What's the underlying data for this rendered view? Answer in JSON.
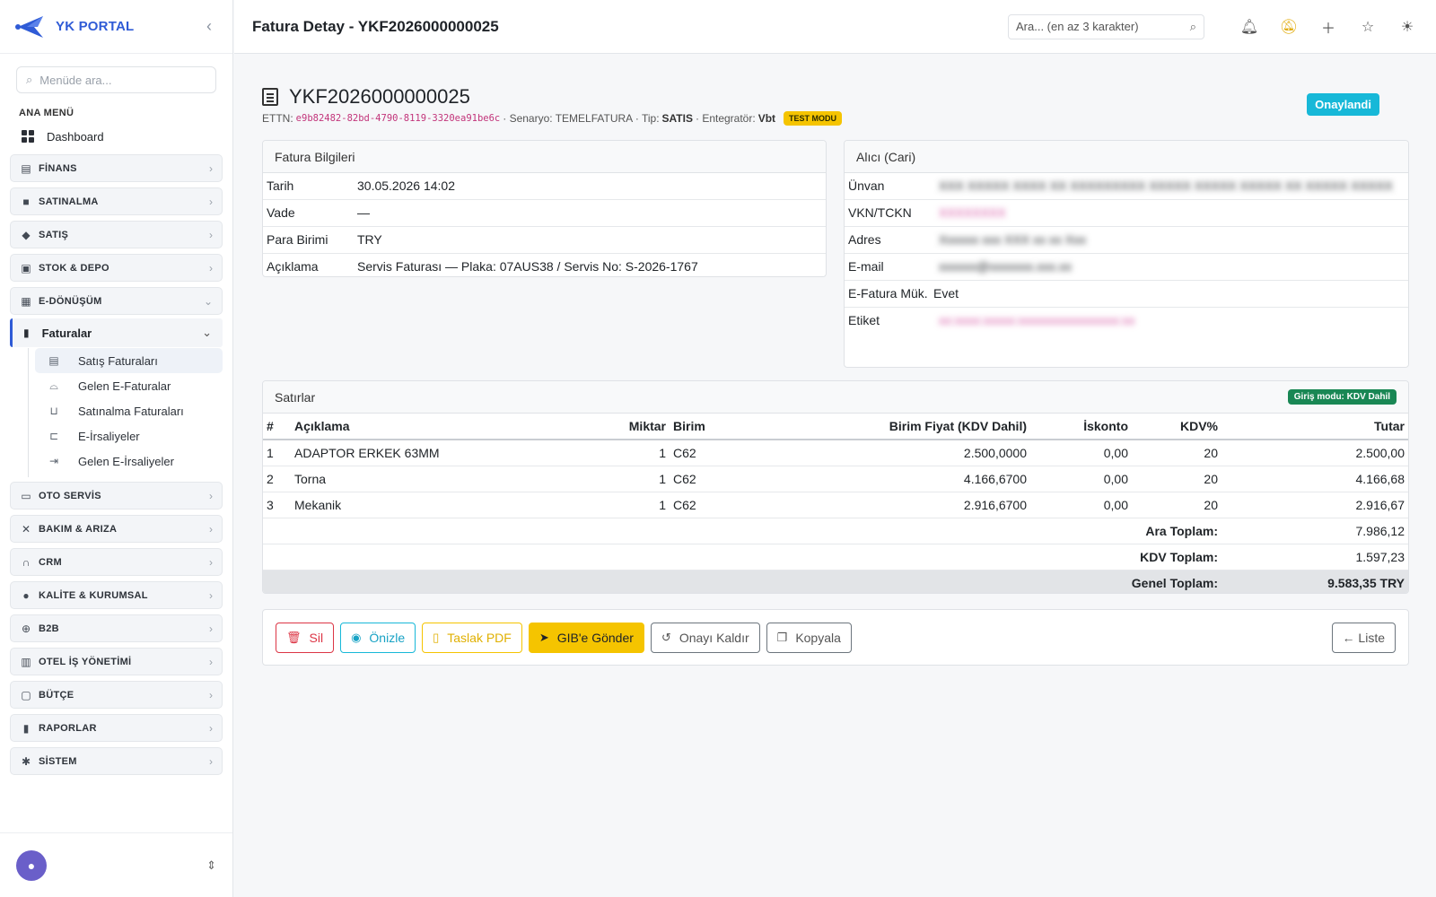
{
  "brand": {
    "name": "YK PORTAL"
  },
  "sidebar": {
    "search_placeholder": "Menüde ara...",
    "section_title": "ANA MENÜ",
    "dashboard_label": "Dashboard",
    "groups": [
      {
        "label": "FİNANS",
        "icon": "bank-icon"
      },
      {
        "label": "SATINALMA",
        "icon": "bag-icon"
      },
      {
        "label": "SATIŞ",
        "icon": "tag-icon"
      },
      {
        "label": "STOK & DEPO",
        "icon": "box-icon"
      },
      {
        "label": "E-DÖNÜŞÜM",
        "icon": "document-icon"
      }
    ],
    "faturalar_label": "Faturalar",
    "sub_items": [
      {
        "label": "Satış Faturaları",
        "icon": "receipt-icon"
      },
      {
        "label": "Gelen E-Faturalar",
        "icon": "inbox-icon"
      },
      {
        "label": "Satınalma Faturaları",
        "icon": "cart-icon"
      },
      {
        "label": "E-İrsaliyeler",
        "icon": "truck-icon"
      },
      {
        "label": "Gelen E-İrsaliyeler",
        "icon": "truck-in-icon"
      }
    ],
    "groups2": [
      {
        "label": "OTO SERVİS",
        "icon": "car-icon"
      },
      {
        "label": "BAKIM & ARIZA",
        "icon": "tools-icon"
      },
      {
        "label": "CRM",
        "icon": "headset-icon"
      },
      {
        "label": "KALİTE & KURUMSAL",
        "icon": "badge-check-icon"
      },
      {
        "label": "B2B",
        "icon": "globe-icon"
      },
      {
        "label": "OTEL İŞ YÖNETİMİ",
        "icon": "building-icon"
      },
      {
        "label": "BÜTÇE",
        "icon": "wallet-icon"
      },
      {
        "label": "RAPORLAR",
        "icon": "chart-icon"
      },
      {
        "label": "SİSTEM",
        "icon": "gear-icon"
      }
    ]
  },
  "topbar": {
    "title": "Fatura Detay - YKF2026000000025",
    "search_placeholder": "Ara... (en az 3 karakter)"
  },
  "invoice": {
    "number": "YKF2026000000025",
    "ettn_label": "ETTN:",
    "ettn": "e9b82482-82bd-4790-8119-3320ea91be6c",
    "senaryo": "· Senaryo: TEMELFATURA · Tip:",
    "tip": "SATIS",
    "entegrator_label": "· Entegratör:",
    "entegrator": "Vbt",
    "test_badge": "TEST MODU",
    "status": "Onaylandi"
  },
  "fatura_bilgileri": {
    "title": "Fatura Bilgileri",
    "rows": [
      {
        "k": "Tarih",
        "v": "30.05.2026 14:02"
      },
      {
        "k": "Vade",
        "v": "—"
      },
      {
        "k": "Para Birimi",
        "v": "TRY"
      },
      {
        "k": "Açıklama",
        "v": "Servis Faturası — Plaka: 07AUS38 / Servis No: S-2026-1767"
      }
    ]
  },
  "alici": {
    "title": "Alıcı (Cari)",
    "unvan_label": "Ünvan",
    "unvan": "XXX XXXXX XXXX XX XXXXXXXXX XXXXX XXXXX XXXXX XX XXXXX XXXXX",
    "vkn_label": "VKN/TCKN",
    "vkn": "XXXXXXXX",
    "adres_label": "Adres",
    "adres": "Xxxxxx xxx XXX xx xx Xxx",
    "email_label": "E-mail",
    "email": "xxxxxx@xxxxxxx.xxx.xx",
    "efatura_label": "E-Fatura Mük.",
    "efatura": "Evet",
    "etiket_label": "Etiket",
    "etiket": "xx:xxxx:xxxxx:xxxxxxxxxxxxxxxx:xx"
  },
  "satirlar": {
    "title": "Satırlar",
    "mode_badge": "Giriş modu: KDV Dahil",
    "headers": {
      "no": "#",
      "aciklama": "Açıklama",
      "miktar": "Miktar",
      "birim": "Birim",
      "fiyat": "Birim Fiyat (KDV Dahil)",
      "iskonto": "İskonto",
      "kdv": "KDV%",
      "tutar": "Tutar"
    },
    "rows": [
      {
        "no": "1",
        "aciklama": "ADAPTOR ERKEK 63MM",
        "miktar": "1",
        "birim": "C62",
        "fiyat": "2.500,0000",
        "iskonto": "0,00",
        "kdv": "20",
        "tutar": "2.500,00"
      },
      {
        "no": "2",
        "aciklama": "Torna",
        "miktar": "1",
        "birim": "C62",
        "fiyat": "4.166,6700",
        "iskonto": "0,00",
        "kdv": "20",
        "tutar": "4.166,68"
      },
      {
        "no": "3",
        "aciklama": "Mekanik",
        "miktar": "1",
        "birim": "C62",
        "fiyat": "2.916,6700",
        "iskonto": "0,00",
        "kdv": "20",
        "tutar": "2.916,67"
      }
    ],
    "ara_toplam_label": "Ara Toplam:",
    "ara_toplam": "7.986,12",
    "kdv_toplam_label": "KDV Toplam:",
    "kdv_toplam": "1.597,23",
    "genel_toplam_label": "Genel Toplam:",
    "genel_toplam": "9.583,35 TRY"
  },
  "actions": {
    "sil": "Sil",
    "onizle": "Önizle",
    "taslak_pdf": "Taslak PDF",
    "gib_gonder": "GIB'e Gönder",
    "onayi_kaldir": "Onayı Kaldır",
    "kopyala": "Kopyala",
    "liste": "← Liste"
  }
}
